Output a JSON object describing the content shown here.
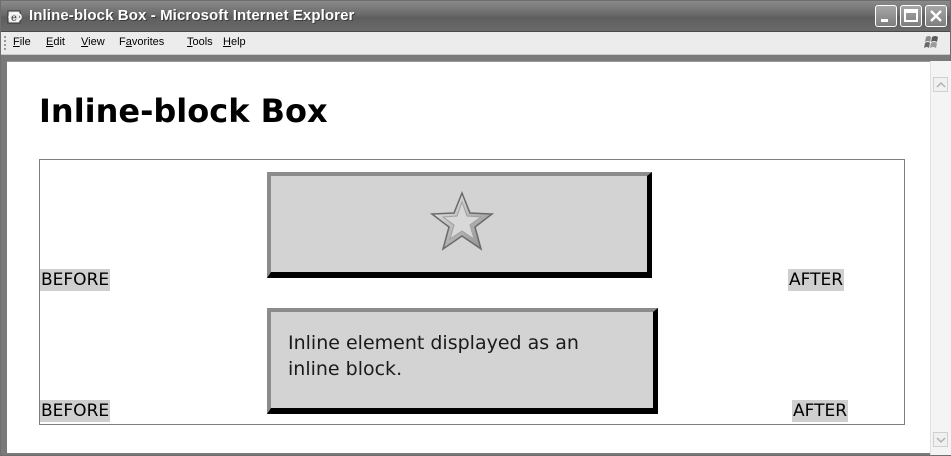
{
  "window": {
    "title": "Inline-block Box - Microsoft Internet Explorer"
  },
  "menu": {
    "items": [
      {
        "label": "File"
      },
      {
        "label": "Edit"
      },
      {
        "label": "View"
      },
      {
        "label": "Favorites"
      },
      {
        "label": "Tools"
      },
      {
        "label": "Help"
      }
    ]
  },
  "page": {
    "heading": "Inline-block Box",
    "row1": {
      "before": "BEFORE",
      "after": "AFTER",
      "image": "star-icon"
    },
    "row2": {
      "before": "BEFORE",
      "text": "Inline element displayed as an inline block.",
      "after": "AFTER"
    }
  },
  "colors": {
    "box_background": "#d3d3d3",
    "marker_background": "#cfcfcf",
    "titlebar": "#6a6a6a"
  }
}
